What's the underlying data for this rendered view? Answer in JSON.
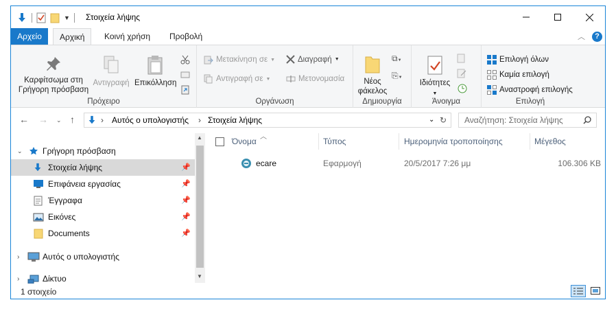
{
  "window": {
    "title": "Στοιχεία λήψης",
    "controls": [
      "minimize",
      "maximize",
      "close"
    ]
  },
  "tabs": {
    "file": "Αρχείο",
    "home": "Αρχική",
    "share": "Κοινή χρήση",
    "view": "Προβολή"
  },
  "ribbon": {
    "clipboard": {
      "label": "Πρόχειρο",
      "pin_line1": "Καρφίτσωμα στη",
      "pin_line2": "Γρήγορη πρόσβαση",
      "copy": "Αντιγραφή",
      "paste": "Επικόλληση"
    },
    "organize": {
      "label": "Οργάνωση",
      "move_to": "Μετακίνηση σε",
      "copy_to": "Αντιγραφή σε",
      "delete": "Διαγραφή",
      "rename": "Μετονομασία"
    },
    "new": {
      "label": "Δημιουργία",
      "new_folder_line1": "Νέος",
      "new_folder_line2": "φάκελος"
    },
    "open": {
      "label": "Άνοιγμα",
      "properties": "Ιδιότητες"
    },
    "select": {
      "label": "Επιλογή",
      "select_all": "Επιλογή όλων",
      "select_none": "Καμία επιλογή",
      "invert": "Αναστροφή επιλογής"
    }
  },
  "address": {
    "crumbs": [
      "Αυτός ο υπολογιστής",
      "Στοιχεία λήψης"
    ],
    "search_placeholder": "Αναζήτηση: Στοιχεία λήψης"
  },
  "nav": {
    "quick_access": "Γρήγορη πρόσβαση",
    "items": [
      {
        "label": "Στοιχεία λήψης",
        "icon": "download-arrow-icon"
      },
      {
        "label": "Επιφάνεια εργασίας",
        "icon": "desktop-icon"
      },
      {
        "label": "Έγγραφα",
        "icon": "document-icon"
      },
      {
        "label": "Εικόνες",
        "icon": "pictures-icon"
      },
      {
        "label": "Documents",
        "icon": "folder-icon"
      }
    ],
    "this_pc": "Αυτός ο υπολογιστής",
    "network": "Δίκτυο"
  },
  "columns": {
    "name": "Όνομα",
    "type": "Τύπος",
    "date": "Ημερομηνία τροποποίησης",
    "size": "Μέγεθος"
  },
  "files": [
    {
      "name": "ecare",
      "type": "Εφαρμογή",
      "date": "20/5/2017 7:26 μμ",
      "size": "106.306 KB"
    }
  ],
  "status": {
    "count": "1 στοιχείο"
  },
  "colors": {
    "accent": "#1979ca",
    "selected_nav": "#d9d9d9",
    "ribbon_bg": "#f5f6f7"
  }
}
